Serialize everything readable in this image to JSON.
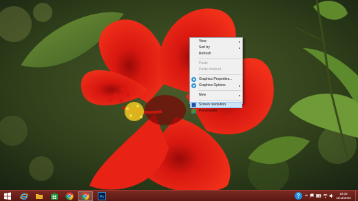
{
  "desktop": {
    "wallpaper": "red-hibiscus-flower"
  },
  "context_menu": {
    "items": [
      {
        "label": "View",
        "submenu": true
      },
      {
        "label": "Sort by",
        "submenu": true
      },
      {
        "label": "Refresh"
      },
      {
        "label": "Paste",
        "disabled": true
      },
      {
        "label": "Paste shortcut",
        "disabled": true
      },
      {
        "label": "Graphics Properties...",
        "icon": "intel-graphics-icon"
      },
      {
        "label": "Graphics Options",
        "icon": "intel-graphics-icon",
        "submenu": true
      },
      {
        "label": "New",
        "submenu": true
      },
      {
        "label": "Screen resolution",
        "icon": "screen-resolution-icon",
        "highlighted": true
      },
      {
        "label": "Personalize",
        "icon": "personalize-icon"
      }
    ],
    "submenu_arrow": "▸"
  },
  "taskbar": {
    "pinned": [
      {
        "name": "start-button",
        "icon": "windows-logo-icon"
      },
      {
        "name": "internet-explorer-button",
        "icon": "internet-explorer-icon"
      },
      {
        "name": "file-explorer-button",
        "icon": "file-explorer-icon"
      },
      {
        "name": "store-button",
        "icon": "store-icon"
      },
      {
        "name": "chrome-button",
        "icon": "chrome-icon"
      },
      {
        "name": "chrome-active-button",
        "icon": "chrome-icon",
        "active": true
      },
      {
        "name": "photoshop-button",
        "icon": "photoshop-icon"
      }
    ],
    "photoshop_label": "Ps",
    "tray": {
      "help_label": "?",
      "time": "19:35",
      "date": "11/11/2015"
    }
  },
  "colors": {
    "taskbar": "#6a2019",
    "menu_bg": "#f0f0f0",
    "menu_highlight": "#cde4f7",
    "flower_red": "#e0140c"
  }
}
